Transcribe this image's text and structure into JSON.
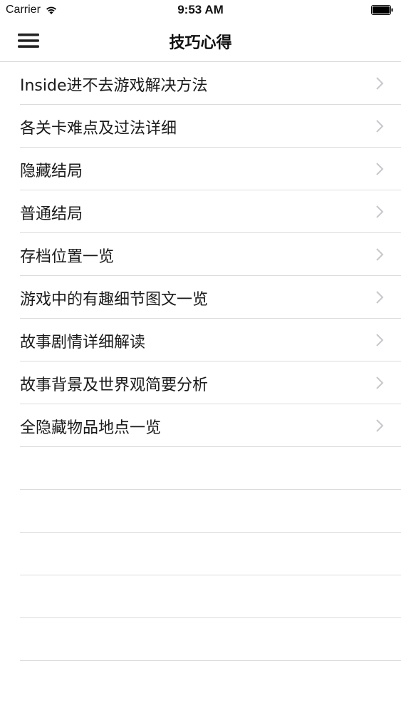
{
  "status_bar": {
    "carrier": "Carrier",
    "time": "9:53 AM",
    "icons": [
      "wifi-icon",
      "battery-icon"
    ]
  },
  "nav": {
    "title": "技巧心得",
    "menu_icon": "hamburger-icon"
  },
  "list": {
    "items": [
      {
        "label": "Inside进不去游戏解决方法"
      },
      {
        "label": "各关卡难点及过法详细"
      },
      {
        "label": "隐藏结局"
      },
      {
        "label": "普通结局"
      },
      {
        "label": "存档位置一览"
      },
      {
        "label": "游戏中的有趣细节图文一览"
      },
      {
        "label": "故事剧情详细解读"
      },
      {
        "label": "故事背景及世界观简要分析"
      },
      {
        "label": "全隐藏物品地点一览"
      }
    ],
    "chevron_icon": "chevron-right-icon"
  },
  "colors": {
    "separator": "#dcdcdc",
    "chevron": "#c7c7cc",
    "text": "#1a1a1a"
  }
}
